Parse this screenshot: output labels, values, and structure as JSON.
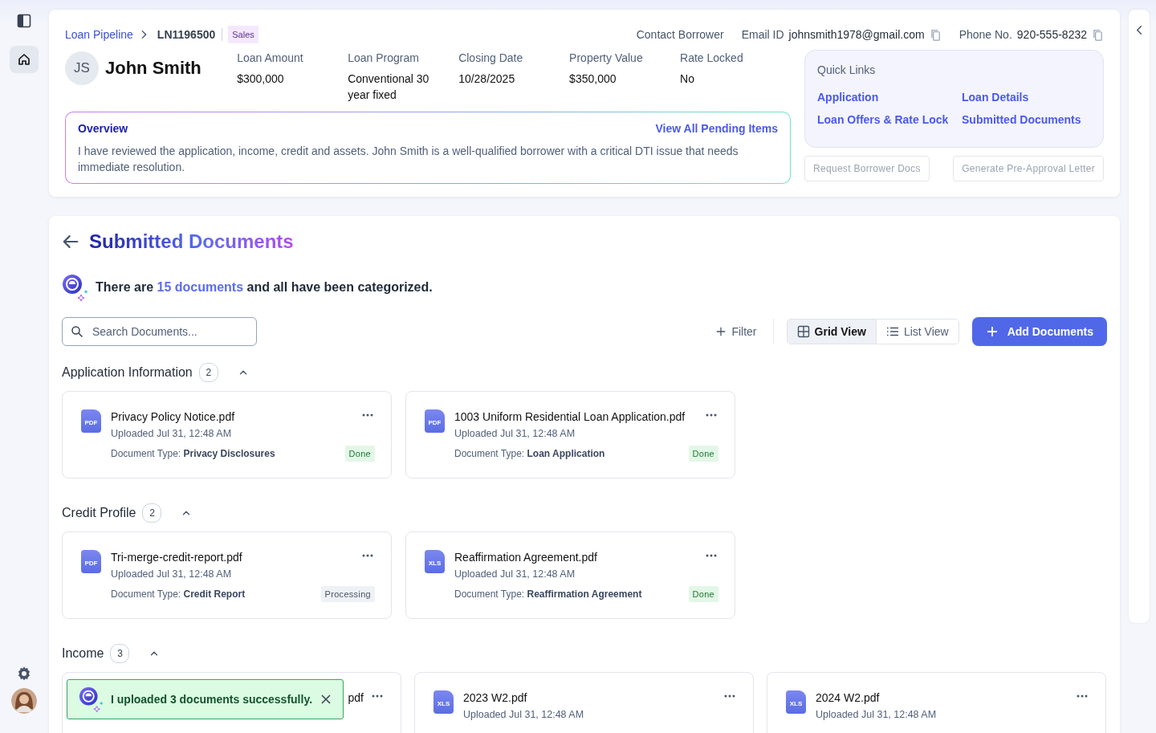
{
  "sidebar": {
    "items": [
      {
        "kind": "home",
        "selected": true
      }
    ]
  },
  "breadcrumb": {
    "parent": "Loan Pipeline",
    "current": "LN1196500",
    "tag": "Sales"
  },
  "contact": {
    "title": "Contact Borrower",
    "email_label": "Email ID",
    "email": "johnsmith1978@gmail.com",
    "phone_label": "Phone No.",
    "phone": "920-555-8232"
  },
  "borrower": {
    "initials": "JS",
    "name": "John Smith"
  },
  "fields": [
    {
      "label": "Loan Amount",
      "value": "$300,000"
    },
    {
      "label": "Loan Program",
      "value": "Conventional 30 year fixed"
    },
    {
      "label": "Closing Date",
      "value": "10/28/2025"
    },
    {
      "label": "Property Value",
      "value": "$350,000"
    },
    {
      "label": "Rate Locked",
      "value": "No"
    }
  ],
  "overview": {
    "title": "Overview",
    "link": "View All Pending Items",
    "text": "I have reviewed the application, income, credit and assets. John Smith is a well-qualified borrower with a critical DTI issue that needs immediate resolution."
  },
  "quick_links": {
    "title": "Quick Links",
    "links": [
      "Application",
      "Loan Details",
      "Loan Offers & Rate Lock",
      "Submitted Documents"
    ]
  },
  "actions": [
    {
      "label": "Request Borrower Docs",
      "disabled": true
    },
    {
      "label": "Generate Pre-Approval Letter",
      "disabled": true
    }
  ],
  "documents": {
    "title": "Submitted Documents",
    "summary": {
      "before": "There are",
      "link": "15 documents",
      "after": "and all have been categorized."
    },
    "search": {
      "placeholder": "Search Documents..."
    },
    "filter": "Filter",
    "views": [
      {
        "label": "Grid View",
        "kind": "grid",
        "selected": true
      },
      {
        "label": "List View",
        "kind": "list",
        "selected": false
      }
    ],
    "add_button": "Add Documents",
    "sections": [
      {
        "title": "Application Information",
        "count": "2",
        "expanded": true,
        "docs": [
          {
            "file_label": "PDF",
            "title": "Privacy Policy Notice.pdf",
            "uploaded": "Uploaded Jul 31, 12:48 AM",
            "type_label": "Document Type:",
            "type": "Privacy Disclosures",
            "status": "Done",
            "complete": true
          },
          {
            "file_label": "PDF",
            "title": "1003 Uniform Residential Loan Application.pdf",
            "uploaded": "Uploaded Jul 31, 12:48 AM",
            "type_label": "Document Type:",
            "type": "Loan Application",
            "status": "Done",
            "complete": true
          }
        ]
      },
      {
        "title": "Credit Profile",
        "count": "2",
        "expanded": true,
        "docs": [
          {
            "file_label": "PDF",
            "title": "Tri-merge-credit-report.pdf",
            "uploaded": "Uploaded Jul 31, 12:48 AM",
            "type_label": "Document Type:",
            "type": "Credit Report",
            "status": "Processing",
            "complete": false
          },
          {
            "file_label": "XLS",
            "title": "Reaffirmation Agreement.pdf",
            "uploaded": "Uploaded Jul 31, 12:48 AM",
            "type_label": "Document Type:",
            "type": "Reaffirmation Agreement",
            "status": "Done",
            "complete": true
          }
        ]
      },
      {
        "title": "Income",
        "count": "3",
        "expanded": true,
        "docs": [
          {
            "covered": true,
            "title": "pdf"
          },
          {
            "file_label": "XLS",
            "title": "2023 W2.pdf",
            "uploaded": "Uploaded Jul 31, 12:48 AM"
          },
          {
            "file_label": "XLS",
            "title": "2024 W2.pdf",
            "uploaded": "Uploaded Jul 31, 12:48 AM"
          }
        ]
      }
    ]
  },
  "toast": {
    "text": "I uploaded 3 documents successfully."
  }
}
